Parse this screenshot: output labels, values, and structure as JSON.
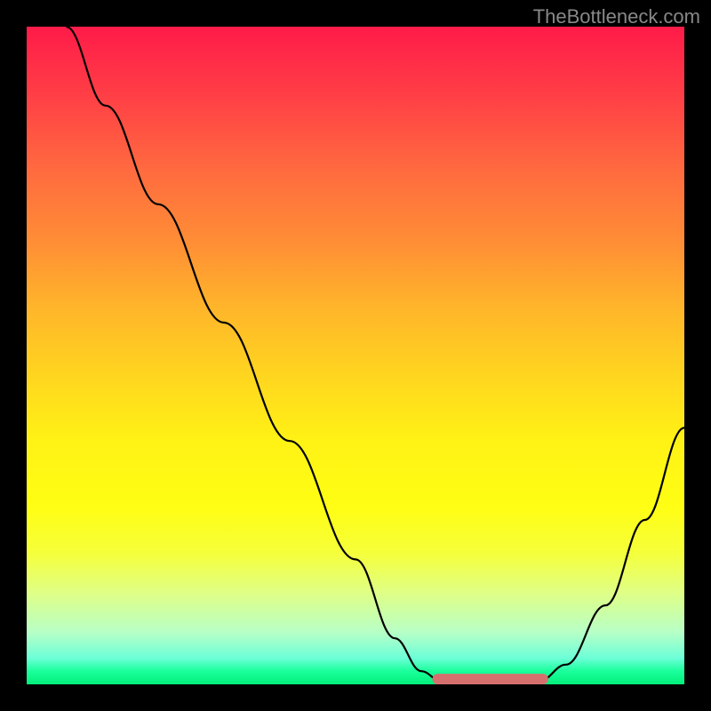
{
  "watermark": "TheBottleneck.com",
  "chart_data": {
    "type": "line",
    "title": "",
    "xlabel": "",
    "ylabel": "",
    "xlim": [
      0,
      100
    ],
    "ylim": [
      0,
      100
    ],
    "grid": false,
    "curve": {
      "left_branch": [
        {
          "x": 6,
          "y": 100
        },
        {
          "x": 12,
          "y": 88
        },
        {
          "x": 20,
          "y": 73
        },
        {
          "x": 30,
          "y": 55
        },
        {
          "x": 40,
          "y": 37
        },
        {
          "x": 50,
          "y": 19
        },
        {
          "x": 56,
          "y": 7
        },
        {
          "x": 60,
          "y": 2
        },
        {
          "x": 63,
          "y": 0.5
        }
      ],
      "flat_bottom": [
        {
          "x": 63,
          "y": 0.5
        },
        {
          "x": 78,
          "y": 0.5
        }
      ],
      "right_branch": [
        {
          "x": 78,
          "y": 0.5
        },
        {
          "x": 82,
          "y": 3
        },
        {
          "x": 88,
          "y": 12
        },
        {
          "x": 94,
          "y": 25
        },
        {
          "x": 100,
          "y": 39
        }
      ]
    },
    "highlight_segment": {
      "start_x": 62.5,
      "end_x": 78.5,
      "y": 0.8,
      "color": "#d6706f"
    },
    "background_gradient": {
      "top": "#ff1b49",
      "middle": "#fff215",
      "bottom": "#02f07a"
    }
  }
}
